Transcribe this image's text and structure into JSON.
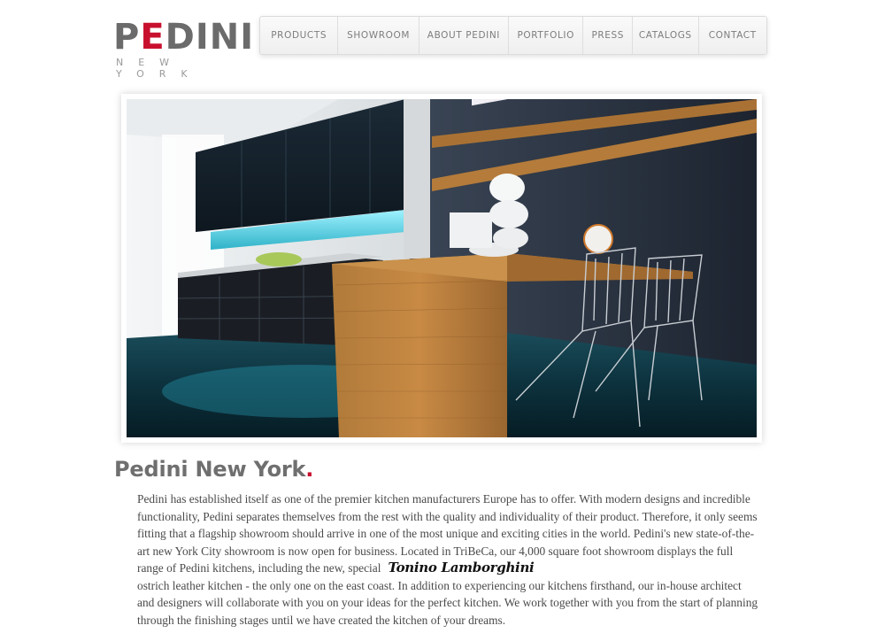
{
  "logo": {
    "main_before": "P",
    "main_e": "E",
    "main_after": "DINI",
    "sub": "NEW YORK"
  },
  "nav": {
    "items": [
      {
        "label": "PRODUCTS"
      },
      {
        "label": "SHOWROOM"
      },
      {
        "label": "ABOUT PEDINI"
      },
      {
        "label": "PORTFOLIO"
      },
      {
        "label": "PRESS"
      },
      {
        "label": "CATALOGS"
      },
      {
        "label": "CONTACT"
      }
    ]
  },
  "hero": {
    "subject": "kitchen showroom photo"
  },
  "content": {
    "title": "Pedini New York",
    "title_dot": ".",
    "para_before_logo": "Pedini has established itself as one of the premier kitchen manufacturers Europe has to offer. With modern designs and incredible functionality, Pedini separates themselves from the rest with the quality and individuality of their product. Therefore, it only seems fitting that a flagship showroom should arrive in one of the most unique and exciting cities in the world.  Pedini's new state-of-the-art new York City showroom is now open for business. Located in TriBeCa, our 4,000 square foot showroom displays the full range of Pedini kitchens, including the new, special",
    "tonino_logo": "Tonino Lamborghini",
    "para_after_logo": "ostrich leather kitchen - the only one on the east coast. In addition to experiencing our kitchens firsthand, our in-house architect and designers will collaborate with you on your ideas for the perfect kitchen. We work together with you from the start of planning through the finishing stages until we have created the kitchen of your dreams."
  },
  "colors": {
    "brand_red": "#c8102e",
    "text_gray": "#4a4a4a",
    "logo_gray": "#6b6b6b"
  }
}
